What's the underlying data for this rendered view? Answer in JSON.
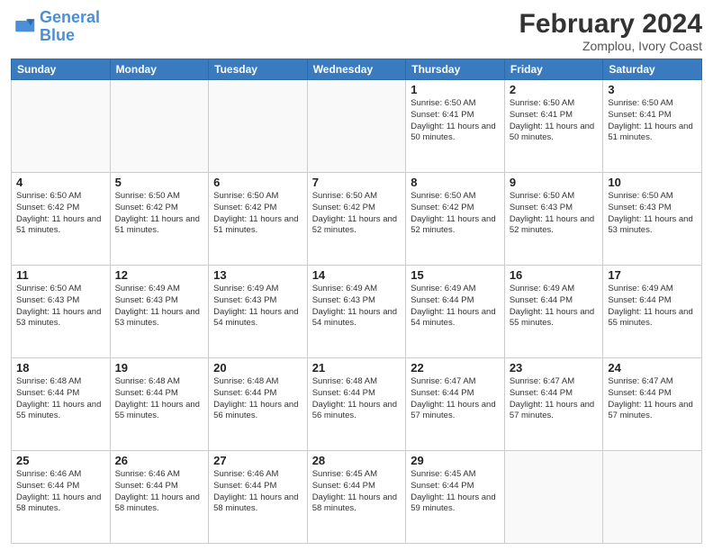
{
  "header": {
    "logo_line1": "General",
    "logo_line2": "Blue",
    "title": "February 2024",
    "subtitle": "Zomplou, Ivory Coast"
  },
  "days_of_week": [
    "Sunday",
    "Monday",
    "Tuesday",
    "Wednesday",
    "Thursday",
    "Friday",
    "Saturday"
  ],
  "weeks": [
    [
      {
        "day": "",
        "info": ""
      },
      {
        "day": "",
        "info": ""
      },
      {
        "day": "",
        "info": ""
      },
      {
        "day": "",
        "info": ""
      },
      {
        "day": "1",
        "info": "Sunrise: 6:50 AM\nSunset: 6:41 PM\nDaylight: 11 hours\nand 50 minutes."
      },
      {
        "day": "2",
        "info": "Sunrise: 6:50 AM\nSunset: 6:41 PM\nDaylight: 11 hours\nand 50 minutes."
      },
      {
        "day": "3",
        "info": "Sunrise: 6:50 AM\nSunset: 6:41 PM\nDaylight: 11 hours\nand 51 minutes."
      }
    ],
    [
      {
        "day": "4",
        "info": "Sunrise: 6:50 AM\nSunset: 6:42 PM\nDaylight: 11 hours\nand 51 minutes."
      },
      {
        "day": "5",
        "info": "Sunrise: 6:50 AM\nSunset: 6:42 PM\nDaylight: 11 hours\nand 51 minutes."
      },
      {
        "day": "6",
        "info": "Sunrise: 6:50 AM\nSunset: 6:42 PM\nDaylight: 11 hours\nand 51 minutes."
      },
      {
        "day": "7",
        "info": "Sunrise: 6:50 AM\nSunset: 6:42 PM\nDaylight: 11 hours\nand 52 minutes."
      },
      {
        "day": "8",
        "info": "Sunrise: 6:50 AM\nSunset: 6:42 PM\nDaylight: 11 hours\nand 52 minutes."
      },
      {
        "day": "9",
        "info": "Sunrise: 6:50 AM\nSunset: 6:43 PM\nDaylight: 11 hours\nand 52 minutes."
      },
      {
        "day": "10",
        "info": "Sunrise: 6:50 AM\nSunset: 6:43 PM\nDaylight: 11 hours\nand 53 minutes."
      }
    ],
    [
      {
        "day": "11",
        "info": "Sunrise: 6:50 AM\nSunset: 6:43 PM\nDaylight: 11 hours\nand 53 minutes."
      },
      {
        "day": "12",
        "info": "Sunrise: 6:49 AM\nSunset: 6:43 PM\nDaylight: 11 hours\nand 53 minutes."
      },
      {
        "day": "13",
        "info": "Sunrise: 6:49 AM\nSunset: 6:43 PM\nDaylight: 11 hours\nand 54 minutes."
      },
      {
        "day": "14",
        "info": "Sunrise: 6:49 AM\nSunset: 6:43 PM\nDaylight: 11 hours\nand 54 minutes."
      },
      {
        "day": "15",
        "info": "Sunrise: 6:49 AM\nSunset: 6:44 PM\nDaylight: 11 hours\nand 54 minutes."
      },
      {
        "day": "16",
        "info": "Sunrise: 6:49 AM\nSunset: 6:44 PM\nDaylight: 11 hours\nand 55 minutes."
      },
      {
        "day": "17",
        "info": "Sunrise: 6:49 AM\nSunset: 6:44 PM\nDaylight: 11 hours\nand 55 minutes."
      }
    ],
    [
      {
        "day": "18",
        "info": "Sunrise: 6:48 AM\nSunset: 6:44 PM\nDaylight: 11 hours\nand 55 minutes."
      },
      {
        "day": "19",
        "info": "Sunrise: 6:48 AM\nSunset: 6:44 PM\nDaylight: 11 hours\nand 55 minutes."
      },
      {
        "day": "20",
        "info": "Sunrise: 6:48 AM\nSunset: 6:44 PM\nDaylight: 11 hours\nand 56 minutes."
      },
      {
        "day": "21",
        "info": "Sunrise: 6:48 AM\nSunset: 6:44 PM\nDaylight: 11 hours\nand 56 minutes."
      },
      {
        "day": "22",
        "info": "Sunrise: 6:47 AM\nSunset: 6:44 PM\nDaylight: 11 hours\nand 57 minutes."
      },
      {
        "day": "23",
        "info": "Sunrise: 6:47 AM\nSunset: 6:44 PM\nDaylight: 11 hours\nand 57 minutes."
      },
      {
        "day": "24",
        "info": "Sunrise: 6:47 AM\nSunset: 6:44 PM\nDaylight: 11 hours\nand 57 minutes."
      }
    ],
    [
      {
        "day": "25",
        "info": "Sunrise: 6:46 AM\nSunset: 6:44 PM\nDaylight: 11 hours\nand 58 minutes."
      },
      {
        "day": "26",
        "info": "Sunrise: 6:46 AM\nSunset: 6:44 PM\nDaylight: 11 hours\nand 58 minutes."
      },
      {
        "day": "27",
        "info": "Sunrise: 6:46 AM\nSunset: 6:44 PM\nDaylight: 11 hours\nand 58 minutes."
      },
      {
        "day": "28",
        "info": "Sunrise: 6:45 AM\nSunset: 6:44 PM\nDaylight: 11 hours\nand 58 minutes."
      },
      {
        "day": "29",
        "info": "Sunrise: 6:45 AM\nSunset: 6:44 PM\nDaylight: 11 hours\nand 59 minutes."
      },
      {
        "day": "",
        "info": ""
      },
      {
        "day": "",
        "info": ""
      }
    ]
  ]
}
